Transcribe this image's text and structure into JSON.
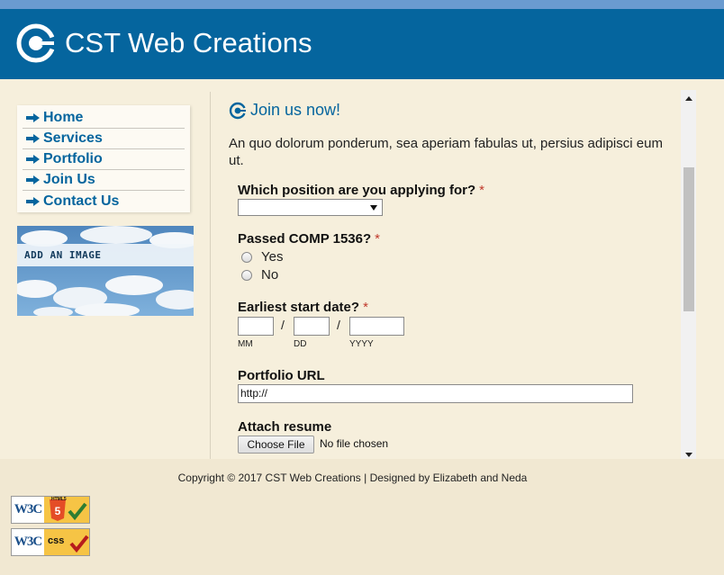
{
  "header": {
    "site_title": "CST Web Creations",
    "logo_icon": "cst-logo-icon"
  },
  "sidebar": {
    "nav": [
      {
        "label": "Home"
      },
      {
        "label": "Services"
      },
      {
        "label": "Portfolio"
      },
      {
        "label": "Join Us"
      },
      {
        "label": "Contact Us"
      }
    ],
    "ad_label": "ADD AN IMAGE"
  },
  "main": {
    "title": "Join us now!",
    "intro": "An quo dolorum ponderum, sea aperiam fabulas ut, persius adipisci eum ut.",
    "position_question": "Which position are you applying for?",
    "position_selected": "",
    "comp_question": "Passed COMP 1536?",
    "comp_options": [
      "Yes",
      "No"
    ],
    "date_question": "Earliest start date?",
    "date_separator": "/",
    "date_captions": [
      "MM",
      "DD",
      "YYYY"
    ],
    "portfolio_label": "Portfolio URL",
    "portfolio_value": "http://",
    "resume_label": "Attach resume",
    "file_button": "Choose File",
    "file_status": "No file chosen",
    "required_mark": "*"
  },
  "footer": {
    "copyright": "Copyright © 2017 CST Web Creations  |  Designed by Elizabeth and Neda",
    "badges": [
      {
        "w3c": "W3C",
        "label": "HTML5"
      },
      {
        "w3c": "W3C",
        "label": "css"
      }
    ]
  },
  "colors": {
    "brand": "#05659e",
    "background": "#f6efdc",
    "footer": "#f1e8d2",
    "required": "#c0392b"
  }
}
